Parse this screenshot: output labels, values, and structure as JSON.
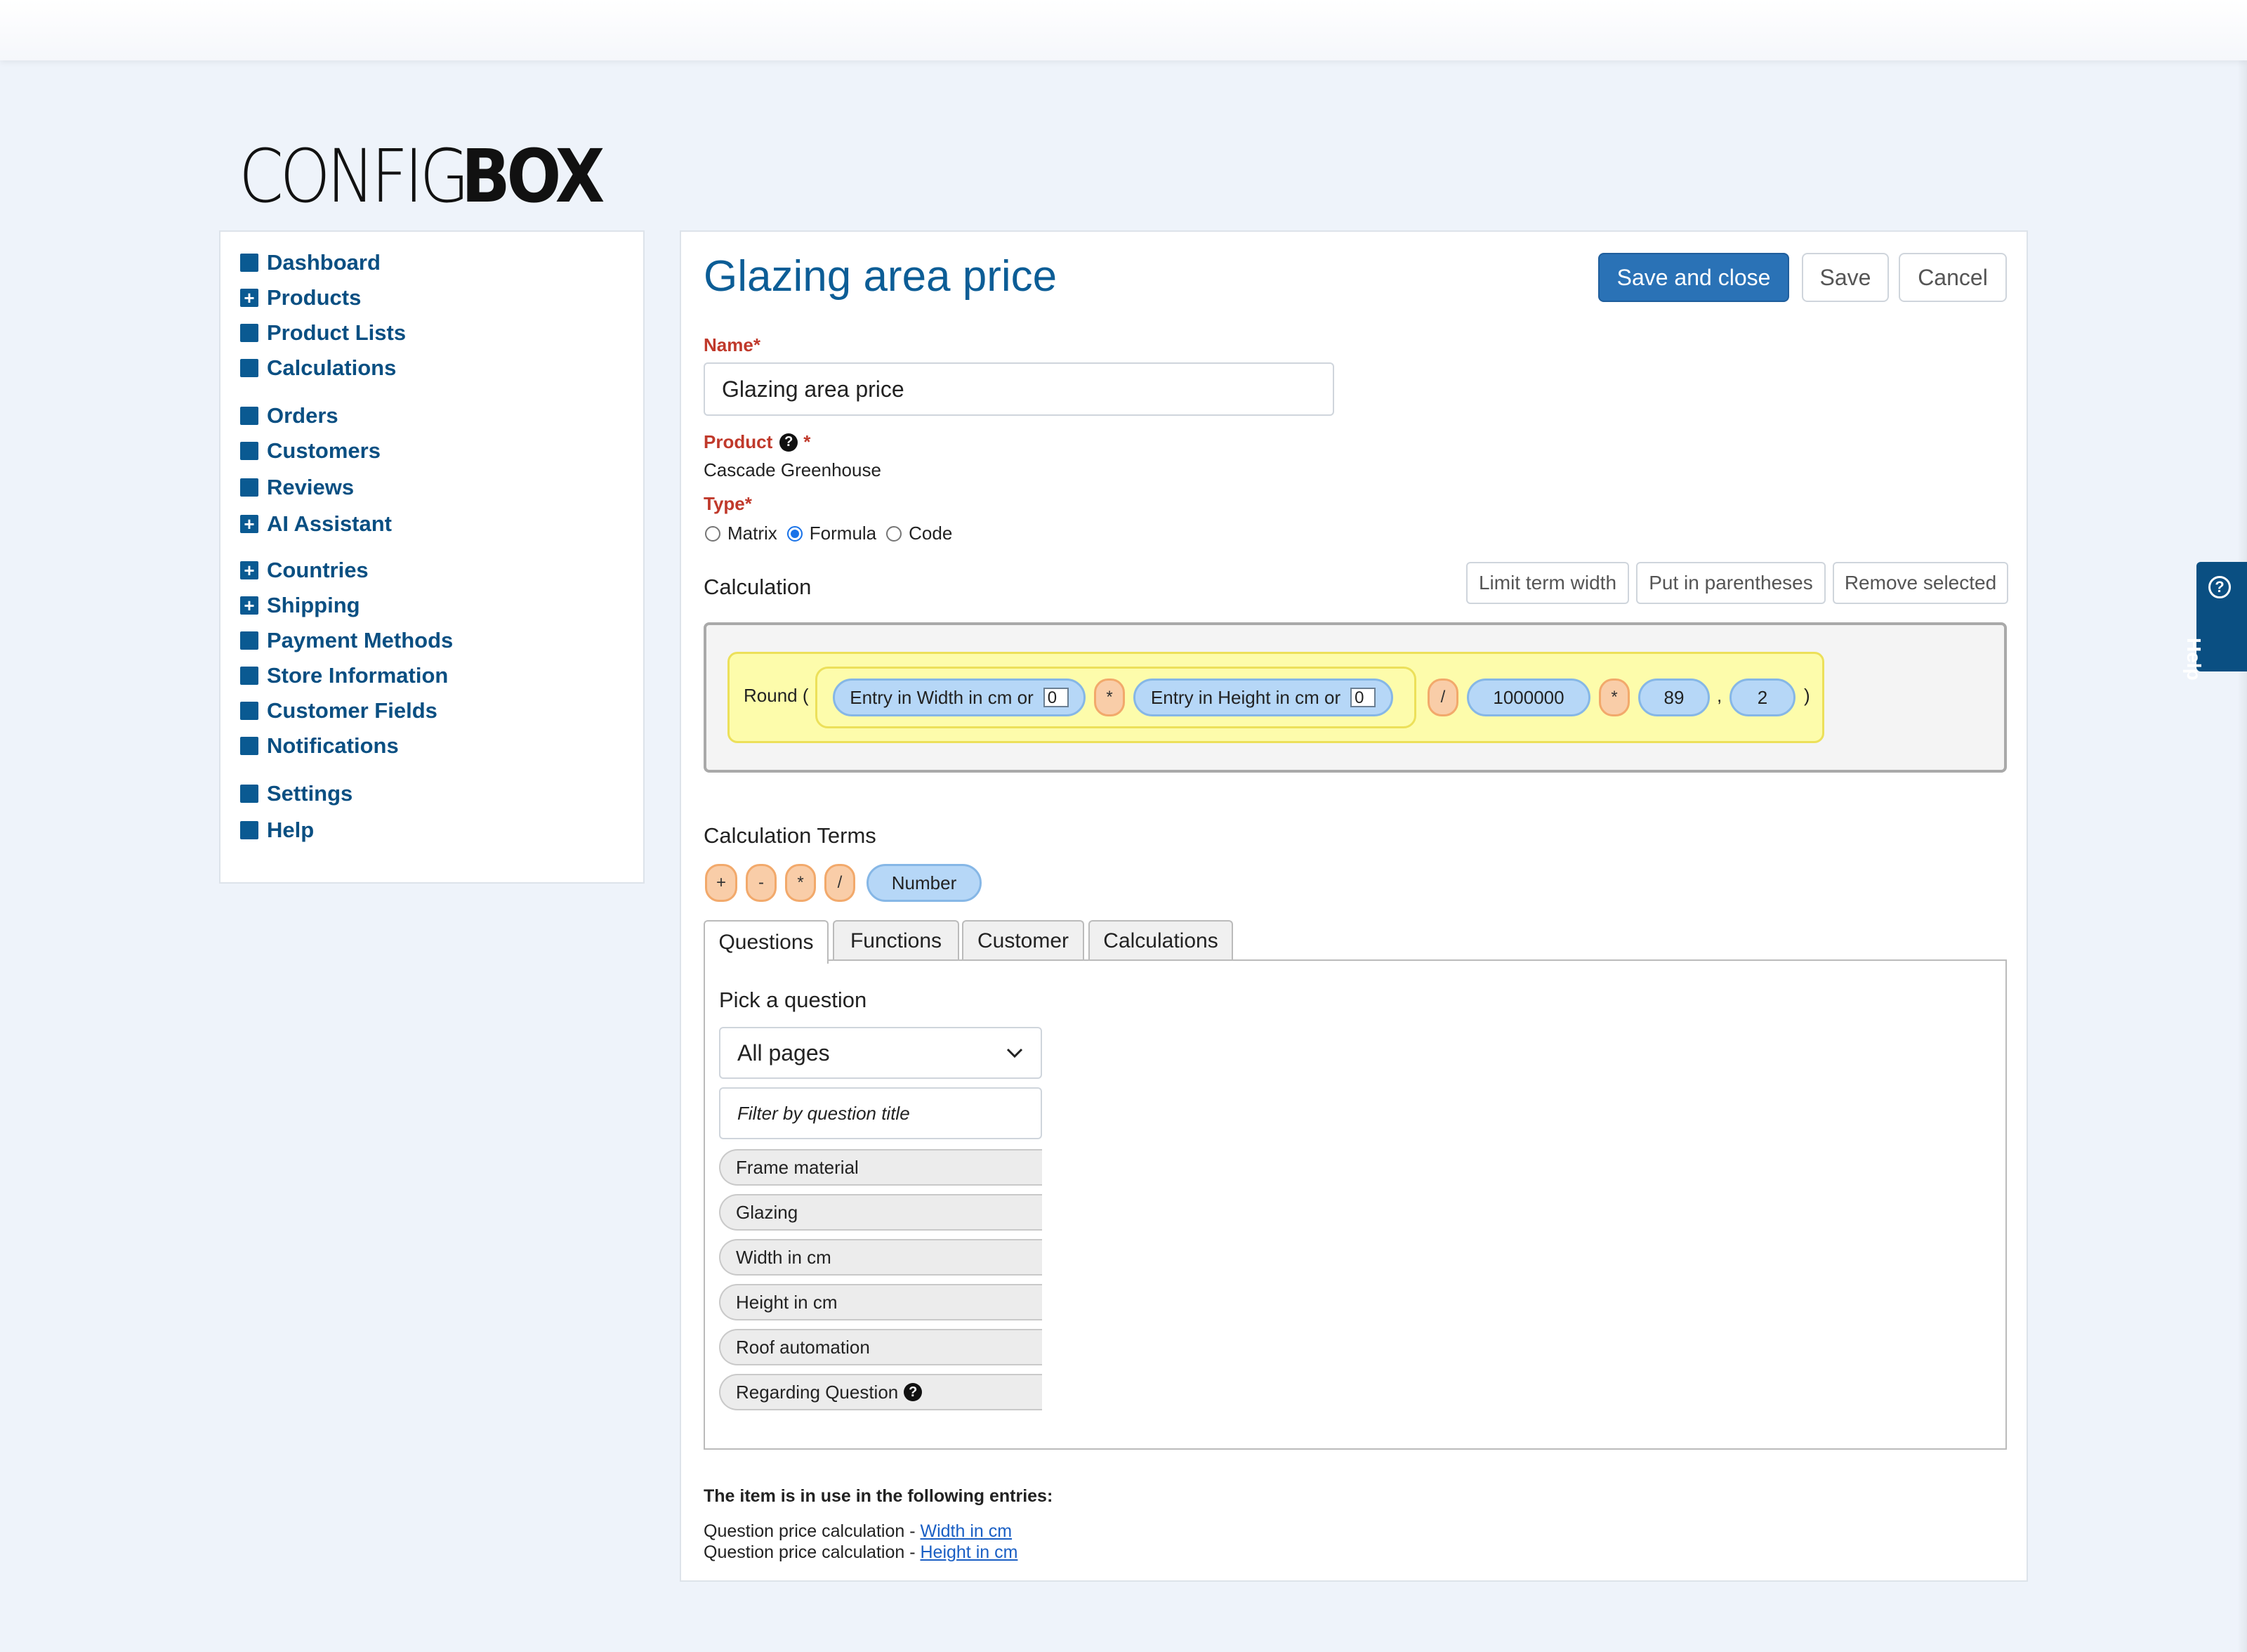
{
  "brand": {
    "logo_part1": "CONFIG",
    "logo_part2": "BOX"
  },
  "sidebar": {
    "items": [
      {
        "label": "Dashboard",
        "icon": "square-icon"
      },
      {
        "label": "Products",
        "icon": "plus-square-icon"
      },
      {
        "label": "Product Lists",
        "icon": "square-icon"
      },
      {
        "label": "Calculations",
        "icon": "square-icon"
      },
      {
        "label": "Orders",
        "icon": "square-icon"
      },
      {
        "label": "Customers",
        "icon": "square-icon"
      },
      {
        "label": "Reviews",
        "icon": "square-icon"
      },
      {
        "label": "AI Assistant",
        "icon": "plus-square-icon"
      },
      {
        "label": "Countries",
        "icon": "plus-square-icon"
      },
      {
        "label": "Shipping",
        "icon": "plus-square-icon"
      },
      {
        "label": "Payment Methods",
        "icon": "square-icon"
      },
      {
        "label": "Store Information",
        "icon": "square-icon"
      },
      {
        "label": "Customer Fields",
        "icon": "square-icon"
      },
      {
        "label": "Notifications",
        "icon": "square-icon"
      },
      {
        "label": "Settings",
        "icon": "square-icon"
      },
      {
        "label": "Help",
        "icon": "square-icon"
      }
    ]
  },
  "page": {
    "title": "Glazing area price",
    "buttons": {
      "save_close": "Save and close",
      "save": "Save",
      "cancel": "Cancel"
    }
  },
  "form": {
    "name_label": "Name",
    "required_mark": "*",
    "name_value": "Glazing area price",
    "product_label": "Product",
    "product_value": "Cascade Greenhouse",
    "type_label": "Type",
    "type_options": [
      "Matrix",
      "Formula",
      "Code"
    ],
    "type_selected": "Formula"
  },
  "calculation": {
    "label": "Calculation",
    "actions": {
      "limit": "Limit term width",
      "paren": "Put in parentheses",
      "remove": "Remove selected"
    },
    "round_open": "Round (",
    "round_close": ")",
    "term1_label": "Entry in Width in cm or",
    "term1_value": "0",
    "op1": "*",
    "term2_label": "Entry in Height in cm or",
    "term2_value": "0",
    "op2": "/",
    "number1": "1000000",
    "op3": "*",
    "number2": "89",
    "comma": ",",
    "number3": "2"
  },
  "terms": {
    "label": "Calculation Terms",
    "operators": [
      "+",
      "-",
      "*",
      "/"
    ],
    "number": "Number"
  },
  "tabs": [
    "Questions",
    "Functions",
    "Customer",
    "Calculations"
  ],
  "active_tab": "Questions",
  "questions": {
    "heading": "Pick a question",
    "page_select": "All pages",
    "filter_placeholder": "Filter by question title",
    "items": [
      "Frame material",
      "Glazing",
      "Width in cm",
      "Height in cm",
      "Roof automation",
      "Regarding Question"
    ]
  },
  "usage": {
    "heading": "The item is in use in the following entries:",
    "entries": [
      {
        "prefix": "Question price calculation - ",
        "link": "Width in cm"
      },
      {
        "prefix": "Question price calculation - ",
        "link": "Height in cm"
      }
    ]
  },
  "help_tab": {
    "label": "Help"
  },
  "colors": {
    "primary": "#2a72b6",
    "nav": "#0a4f82",
    "title": "#0c5d96",
    "required": "#c0392b"
  }
}
